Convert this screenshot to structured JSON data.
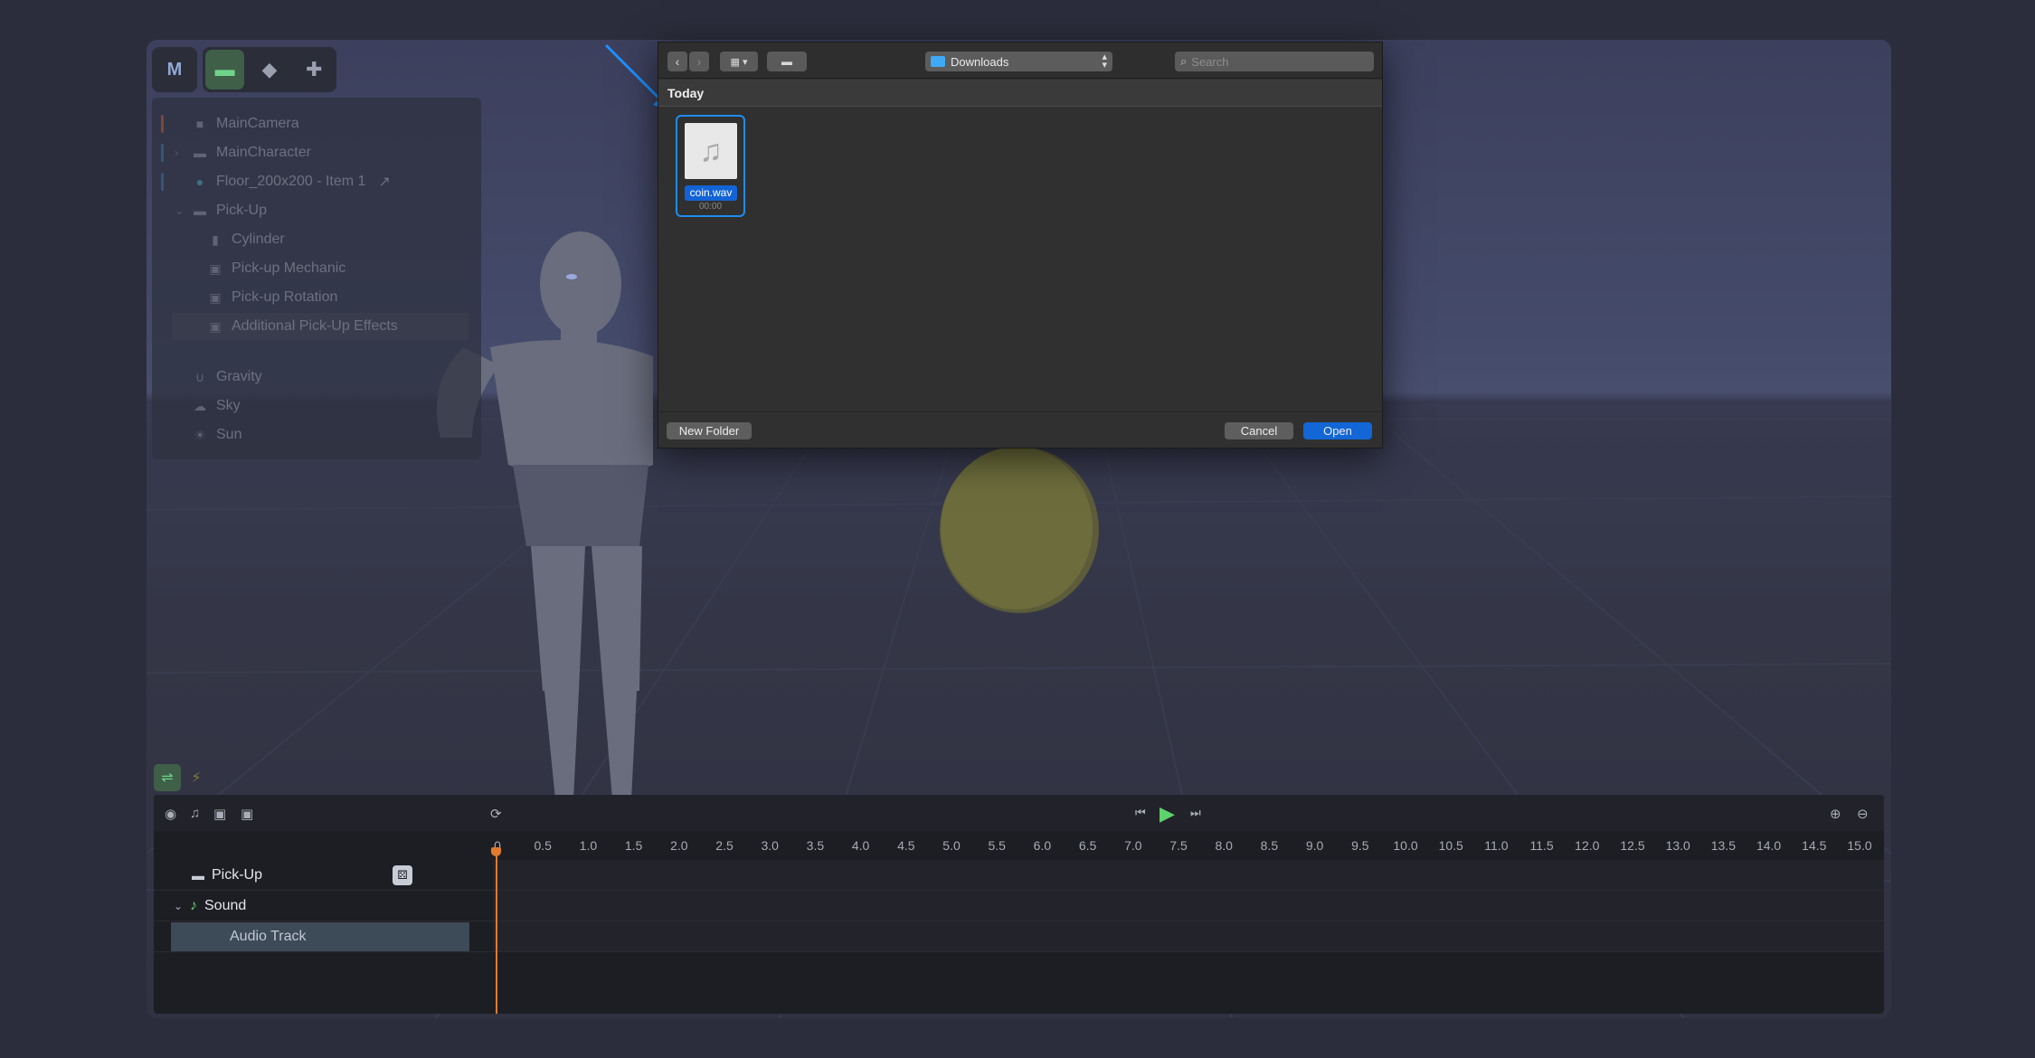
{
  "toolbar": {
    "app_logo": "logo-icon",
    "tabs": [
      "folder-icon",
      "shapes-icon",
      "puzzle-icon"
    ]
  },
  "hierarchy": {
    "items": [
      {
        "label": "MainCamera",
        "icon": "camera-icon",
        "color": "#d06a3a"
      },
      {
        "label": "MainCharacter",
        "icon": "folder-icon",
        "color": "#3a8fd0"
      },
      {
        "label": "Floor_200x200 - Item 1",
        "icon": "sphere-icon",
        "color": "#3a8fd0",
        "suffix": "↗"
      },
      {
        "label": "Pick-Up",
        "icon": "folder-icon"
      },
      {
        "label": "Cylinder",
        "icon": "cylinder-icon"
      },
      {
        "label": "Pick-up Mechanic",
        "icon": "script-icon"
      },
      {
        "label": "Pick-up Rotation",
        "icon": "script-icon"
      },
      {
        "label": "Additional Pick-Up Effects",
        "icon": "script-icon"
      },
      {
        "label": "Gravity",
        "icon": "magnet-icon"
      },
      {
        "label": "Sky",
        "icon": "cloud-icon"
      },
      {
        "label": "Sun",
        "icon": "sun-icon"
      }
    ]
  },
  "dialog": {
    "location": "Downloads",
    "search_placeholder": "Search",
    "section": "Today",
    "file": {
      "name": "coin.wav",
      "duration": "00:00"
    },
    "new_folder": "New Folder",
    "cancel": "Cancel",
    "open": "Open"
  },
  "timeline": {
    "ticks": [
      "0",
      "0.5",
      "1.0",
      "1.5",
      "2.0",
      "2.5",
      "3.0",
      "3.5",
      "4.0",
      "4.5",
      "5.0",
      "5.5",
      "6.0",
      "6.5",
      "7.0",
      "7.5",
      "8.0",
      "8.5",
      "9.0",
      "9.5",
      "10.0",
      "10.5",
      "11.0",
      "11.5",
      "12.0",
      "12.5",
      "13.0",
      "13.5",
      "14.0",
      "14.5",
      "15.0"
    ],
    "rows": [
      {
        "label": "Pick-Up"
      },
      {
        "label": "Sound"
      },
      {
        "label": "Audio Track"
      }
    ]
  },
  "colors": {
    "accent": "#1366d6",
    "playhead": "#e07a2d",
    "play": "#5ed36c"
  }
}
